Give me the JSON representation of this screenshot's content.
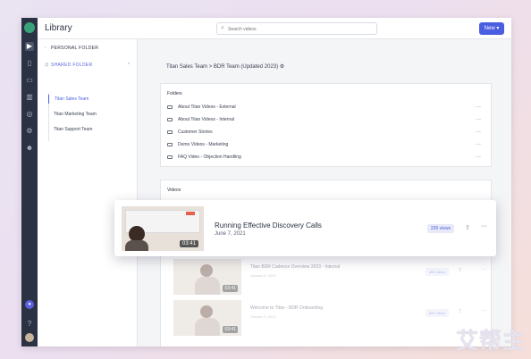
{
  "app": {
    "title": "Library"
  },
  "search": {
    "placeholder": "Search videos"
  },
  "header": {
    "new_label": "New ▾"
  },
  "sidebar": {
    "personal_label": "PERSONAL FOLDER",
    "shared_label": "SHARED FOLDER",
    "items": [
      {
        "label": "Titan Sales Team",
        "selected": true
      },
      {
        "label": "Titan Marketing Team",
        "selected": false
      },
      {
        "label": "Titan Support Team",
        "selected": false
      }
    ]
  },
  "breadcrumb": "Titan Sales Team > BDR Team (Updated 2023) ⚙",
  "folders": {
    "title": "Folders",
    "items": [
      "About Titan Videos - External",
      "About Titan Videos - Internal",
      "Customer Stories",
      "Demo Videos - Marketing",
      "FAQ Video - Objection Handling"
    ]
  },
  "videos": {
    "title": "Videos",
    "highlight": {
      "title": "Running Effective Discovery Calls",
      "date": "June 7, 2021",
      "views": "239 views",
      "duration": "03:41"
    },
    "items": [
      {
        "title": "Titan BDR Cadence Overview 2023 - Internal",
        "date": "January 5, 2023",
        "views": "490 views",
        "duration": "03:41"
      },
      {
        "title": "Welcome to Titan - BDR Onboarding",
        "date": "October 3, 2022",
        "views": "867 views",
        "duration": "03:41"
      }
    ]
  },
  "watermark": "艾帮主",
  "colors": {
    "accent": "#4a5ee0",
    "rail": "#2a3244"
  }
}
